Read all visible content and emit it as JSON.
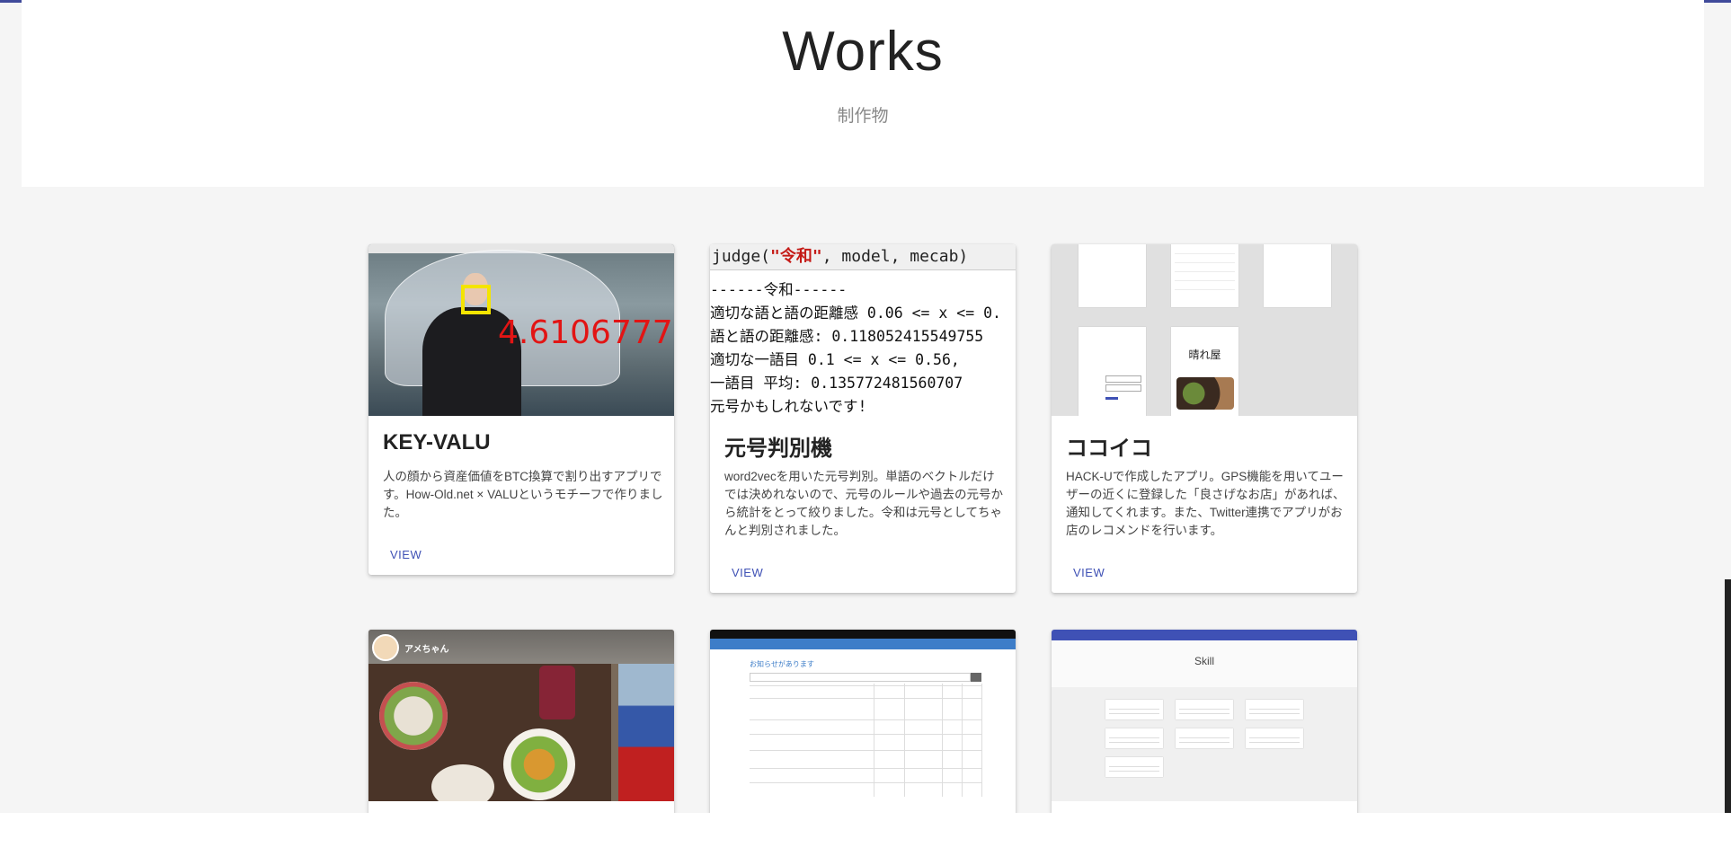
{
  "header": {
    "title": "Works",
    "subtitle": "制作物"
  },
  "works": [
    {
      "title": "KEY-VALU",
      "description": "人の顔から資産価値をBTC換算で割り出すアプリです。How-Old.net × VALUというモチーフで作りました。",
      "view_label": "VIEW",
      "thumbnail": {
        "score_text": "4.6106777"
      }
    },
    {
      "title": "元号判別機",
      "description": "word2vecを用いた元号判別。単語のベクトルだけでは決めれないので、元号のルールや過去の元号から統計をとって絞りました。令和は元号としてちゃんと判別されました。",
      "view_label": "VIEW",
      "thumbnail": {
        "code_prefix": "judge(",
        "code_arg": "\"令和\"",
        "code_suffix": ", model, mecab)",
        "output_lines": [
          "------令和------",
          "適切な語と語の距離感 0.06 <= x <= 0.",
          "語と語の距離感: 0.118052415549755",
          "適切な一語目 0.1 <= x <= 0.56,",
          "一語目  平均: 0.135772481560707",
          "元号かもしれないです!"
        ]
      }
    },
    {
      "title": "ココイコ",
      "description": "HACK-Uで作成したアプリ。GPS機能を用いてユーザーの近くに登録した「良さげなお店」があれば、通知してくれます。また、Twitter連携でアプリがお店のレコメンドを行います。",
      "view_label": "VIEW",
      "thumbnail": {
        "shop_name": "晴れ屋"
      }
    },
    {
      "thumbnail": {
        "user_name": "アメちゃん"
      }
    },
    {
      "thumbnail": {
        "heading": "お知らせがあります"
      }
    },
    {
      "thumbnail": {
        "heading": "Skill"
      }
    }
  ],
  "colors": {
    "accent": "#3f51b5",
    "background": "#f5f5f5",
    "card": "#ffffff",
    "score_red": "#e21414",
    "face_box": "#f4e400"
  }
}
